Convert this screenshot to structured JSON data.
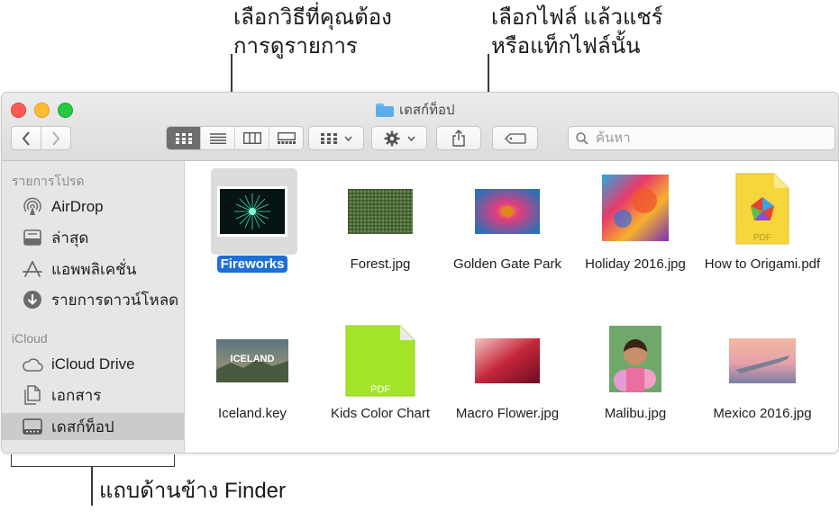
{
  "callouts": {
    "view_line1": "เลือกวิธีที่คุณต้อง",
    "view_line2": "การดูรายการ",
    "share_line1": "เลือกไฟล์ แล้วแชร์",
    "share_line2": "หรือแท็กไฟล์นั้น",
    "sidebar": "แถบด้านข้าง Finder"
  },
  "window": {
    "title": "เดสก์ท็อป",
    "search_placeholder": "ค้นหา"
  },
  "sidebar": {
    "favorites_header": "รายการโปรด",
    "favorites": [
      {
        "label": "AirDrop",
        "icon": "airdrop-icon"
      },
      {
        "label": "ล่าสุด",
        "icon": "recents-icon"
      },
      {
        "label": "แอพพลิเคชั่น",
        "icon": "applications-icon"
      },
      {
        "label": "รายการดาวน์โหลด",
        "icon": "downloads-icon"
      }
    ],
    "icloud_header": "iCloud",
    "icloud": [
      {
        "label": "iCloud Drive",
        "icon": "cloud-icon"
      },
      {
        "label": "เอกสาร",
        "icon": "documents-icon"
      },
      {
        "label": "เดสก์ท็อป",
        "icon": "desktop-icon",
        "selected": true
      }
    ]
  },
  "files": [
    {
      "name": "Fireworks",
      "selected": true
    },
    {
      "name": "Forest.jpg"
    },
    {
      "name": "Golden Gate Park"
    },
    {
      "name": "Holiday 2016.jpg"
    },
    {
      "name": "How to Origami.pdf"
    },
    {
      "name": "Iceland.key",
      "thumb_text": "ICELAND"
    },
    {
      "name": "Kids Color Chart",
      "thumb_text": "PDF"
    },
    {
      "name": "Macro Flower.jpg"
    },
    {
      "name": "Malibu.jpg"
    },
    {
      "name": "Mexico 2016.jpg"
    }
  ],
  "pdf_badge": "PDF",
  "colors": {
    "selection": "#1d6fd8",
    "sidebar_bg": "#e6e6e6",
    "toolbar_bg": "#dcdcdc"
  }
}
